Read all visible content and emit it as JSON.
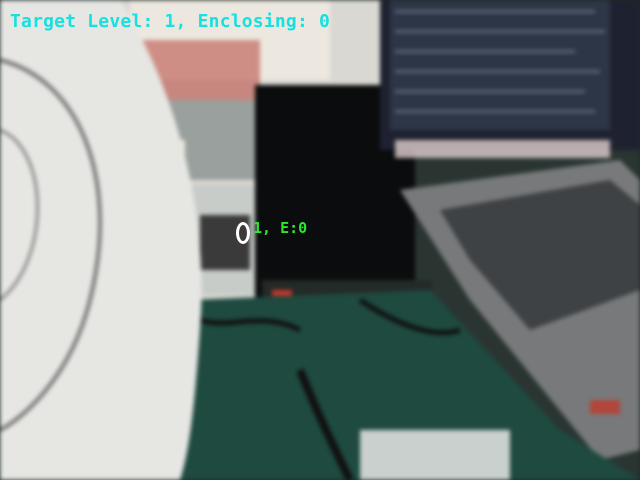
{
  "overlay": {
    "title": "Target Level: 1, Enclosing: 0",
    "title_color": "#16e0e0",
    "marker_label": "1, E:0",
    "marker_label_color": "#2ce82c",
    "marker_color": "#ffffff"
  },
  "scene": {
    "description_icons": [
      "white-fan-shape",
      "monitor",
      "laptop",
      "cable",
      "desk-mat"
    ]
  }
}
